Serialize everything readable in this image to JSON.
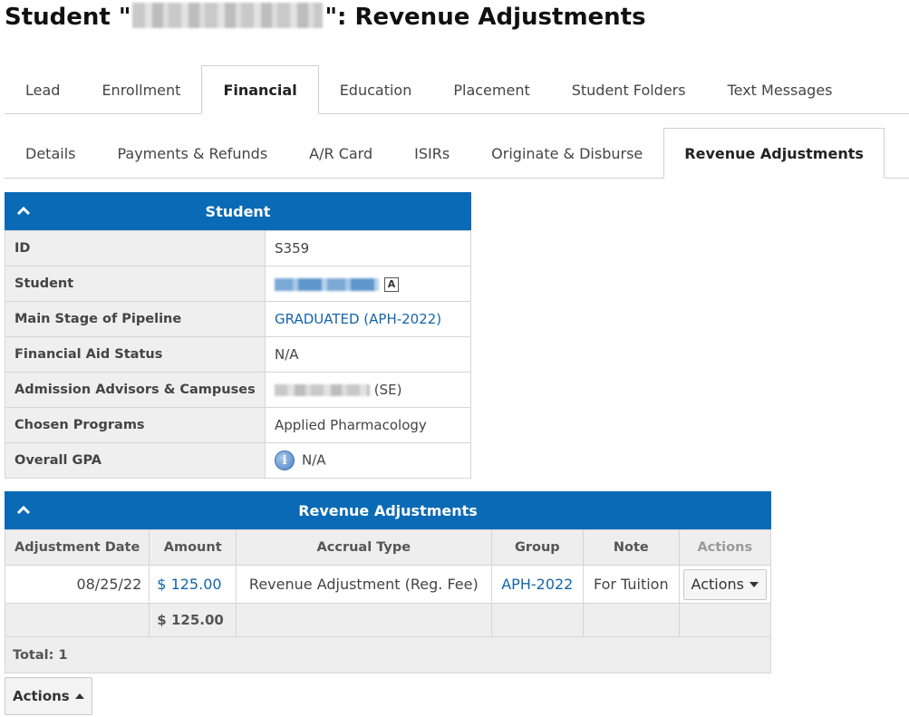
{
  "title": {
    "prefix": "Student \"",
    "suffix": "\": Revenue Adjustments"
  },
  "primary_tabs": [
    {
      "label": "Lead",
      "active": false
    },
    {
      "label": "Enrollment",
      "active": false
    },
    {
      "label": "Financial",
      "active": true
    },
    {
      "label": "Education",
      "active": false
    },
    {
      "label": "Placement",
      "active": false
    },
    {
      "label": "Student Folders",
      "active": false
    },
    {
      "label": "Text Messages",
      "active": false
    }
  ],
  "secondary_tabs": [
    {
      "label": "Details",
      "active": false
    },
    {
      "label": "Payments & Refunds",
      "active": false
    },
    {
      "label": "A/R Card",
      "active": false
    },
    {
      "label": "ISIRs",
      "active": false
    },
    {
      "label": "Originate & Disburse",
      "active": false
    },
    {
      "label": "Revenue Adjustments",
      "active": true
    }
  ],
  "student_panel": {
    "title": "Student",
    "rows": {
      "id": {
        "label": "ID",
        "value": "S359"
      },
      "student": {
        "label": "Student",
        "badge": "A"
      },
      "pipeline": {
        "label": "Main Stage of Pipeline",
        "value": "GRADUATED (APH-2022)"
      },
      "fa_status": {
        "label": "Financial Aid Status",
        "value": "N/A"
      },
      "advisors": {
        "label": "Admission Advisors & Campuses",
        "value_suffix": "(SE)"
      },
      "programs": {
        "label": "Chosen Programs",
        "value": "Applied Pharmacology"
      },
      "gpa": {
        "label": "Overall GPA",
        "value": "N/A",
        "icon": "info-icon"
      }
    }
  },
  "revenue_panel": {
    "title": "Revenue Adjustments",
    "columns": {
      "date": "Adjustment Date",
      "amount": "Amount",
      "accrual": "Accrual Type",
      "group": "Group",
      "note": "Note",
      "actions": "Actions"
    },
    "rows": [
      {
        "date": "08/25/22",
        "amount": "$ 125.00",
        "accrual": "Revenue Adjustment (Reg. Fee)",
        "group": "APH-2022",
        "note": "For Tuition",
        "actions_label": "Actions"
      }
    ],
    "sum_amount": "$ 125.00",
    "total_label": "Total: 1"
  },
  "bottom_actions_label": "Actions",
  "colors": {
    "header_blue": "#0a6ab5",
    "link_blue": "#1565a8"
  }
}
